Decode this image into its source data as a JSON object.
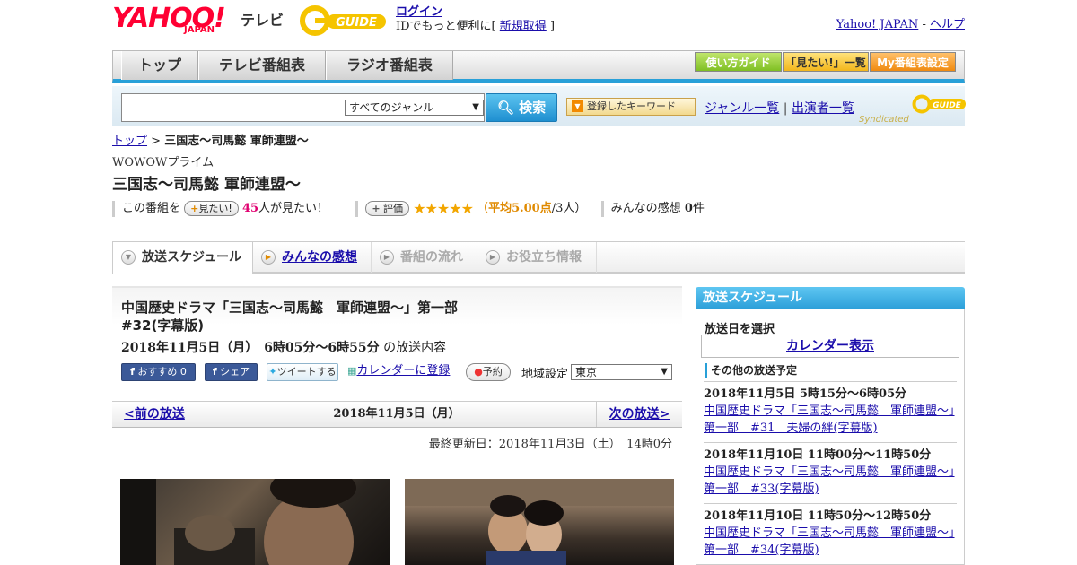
{
  "header": {
    "logo_text": "YAHOO!",
    "logo_sub": "JAPAN",
    "service_name": "テレビ",
    "gguide_logo": "G GUIDE",
    "login_link": "ログイン",
    "login_prompt": "IDでもっと便利に[",
    "register_link": "新規取得",
    "login_close": "]",
    "yahoo_japan_link": "Yahoo! JAPAN",
    "separator": " - ",
    "help_link": "ヘルプ"
  },
  "nav": {
    "tabs": [
      "トップ",
      "テレビ番組表",
      "ラジオ番組表"
    ],
    "guide_buttons": [
      "使い方ガイド",
      "「見たい!」一覧",
      "My番組表設定"
    ]
  },
  "search": {
    "placeholder": "",
    "genre_selected": "すべてのジャンル",
    "search_button": "検索",
    "keyword_button": "登録したキーワード",
    "genre_link": "ジャンル一覧",
    "link_sep": "|",
    "performer_link": "出演者一覧",
    "syndicated": "Syndicated"
  },
  "breadcrumb": {
    "top": "トップ",
    "sep": " > ",
    "current": "三国志～司馬懿 軍師連盟～"
  },
  "program": {
    "channel": "WOWOWプライム",
    "title": "三国志～司馬懿 軍師連盟～",
    "watch_prefix": "この番組を",
    "watch_button": "見たい!",
    "watch_count": "45",
    "watch_suffix": "人が見たい！",
    "rate_button": "評価",
    "stars": "★★★★★",
    "avg_open": "（",
    "avg_label": "平均5.00点",
    "avg_count": "/3人）",
    "reviews_prefix": "みんなの感想",
    "reviews_count": "0",
    "reviews_suffix": "件"
  },
  "program_tabs": [
    {
      "label": "放送スケジュール",
      "state": "active"
    },
    {
      "label": "みんなの感想",
      "state": "link"
    },
    {
      "label": "番組の流れ",
      "state": "disabled"
    },
    {
      "label": "お役立ち情報",
      "state": "disabled"
    }
  ],
  "episode": {
    "title_line1": "中国歴史ドラマ「三国志～司馬懿　軍師連盟～」第一部",
    "title_line2": "#32(字幕版)",
    "date_time": "2018年11月5日（月）　6時05分～6時55分",
    "date_suffix": "の放送内容",
    "fb_recommend": "おすすめ",
    "fb_count": "0",
    "fb_share": "シェア",
    "tweet": "ツイートする",
    "calendar_register": "カレンダーに登録",
    "reserve": "予約",
    "region_label": "地域設定",
    "region_selected": "東京",
    "prev_link": "<前の放送",
    "nav_date": "2018年11月5日（月）",
    "next_link": "次の放送>",
    "last_updated": "最終更新日：2018年11月3日（土）　14時0分"
  },
  "sidebar": {
    "header": "放送スケジュール",
    "select_date": "放送日を選択",
    "calendar_button": "カレンダー表示",
    "other_label": "その他の放送予定",
    "items": [
      {
        "when": "2018年11月5日  5時15分～6時05分",
        "title": "中国歴史ドラマ「三国志～司馬懿　軍師連盟～」第一部　#31　夫婦の絆(字幕版)"
      },
      {
        "when": "2018年11月10日  11時00分～11時50分",
        "title": "中国歴史ドラマ「三国志～司馬懿　軍師連盟～」第一部　#33(字幕版)"
      },
      {
        "when": "2018年11月10日  11時50分～12時50分",
        "title": "中国歴史ドラマ「三国志～司馬懿　軍師連盟～」第一部　#34(字幕版)"
      }
    ]
  },
  "colors": {
    "accent_blue": "#28a0d8",
    "link": "#1a0dab",
    "brand_red": "#ff0033",
    "star": "#f2a600"
  }
}
